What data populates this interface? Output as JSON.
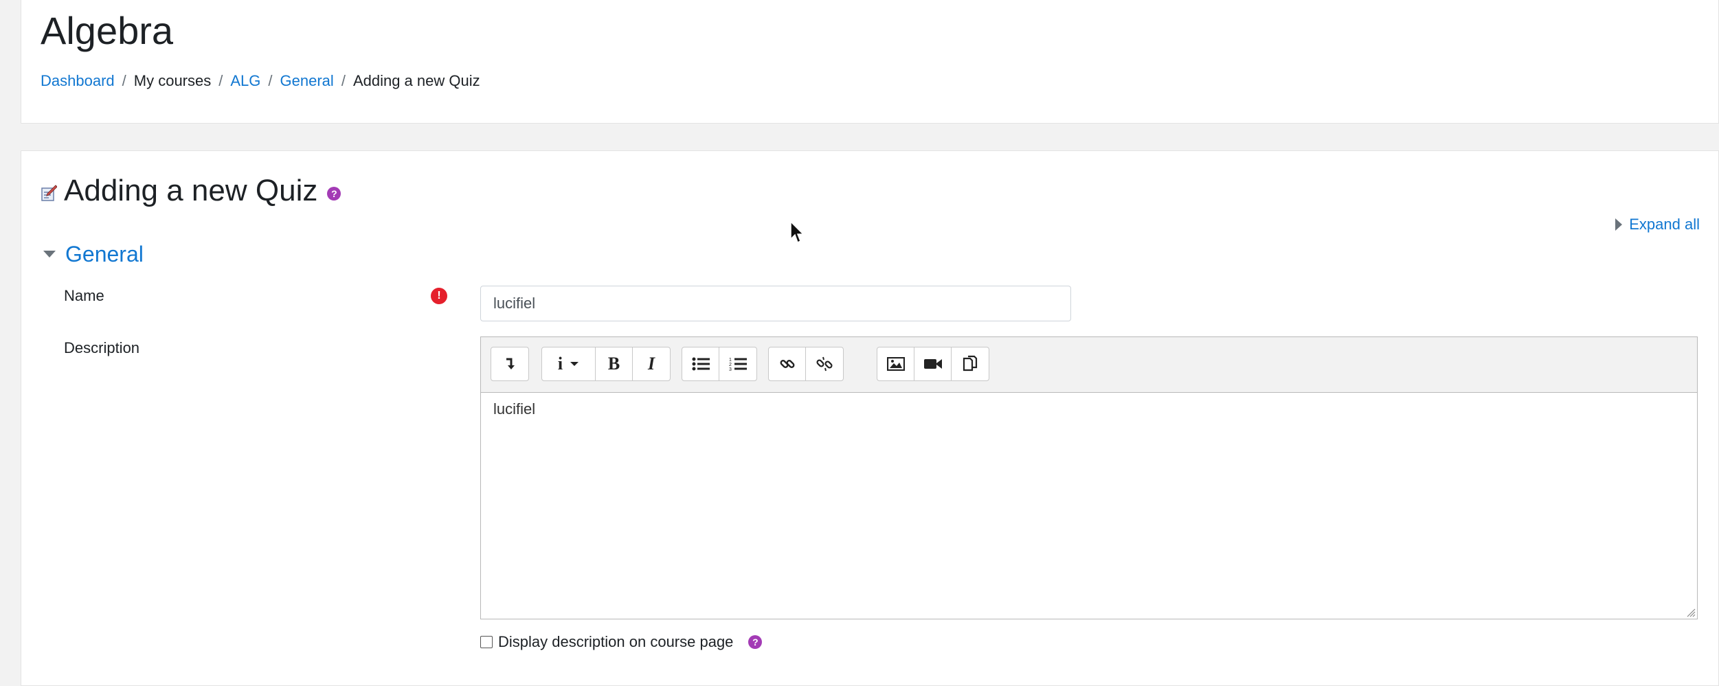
{
  "header": {
    "course_title": "Algebra",
    "breadcrumb": [
      {
        "label": "Dashboard",
        "link": true
      },
      {
        "label": "My courses",
        "link": false
      },
      {
        "label": "ALG",
        "link": true
      },
      {
        "label": "General",
        "link": true
      },
      {
        "label": "Adding a new Quiz",
        "link": false
      }
    ],
    "separator": "/"
  },
  "main": {
    "heading": "Adding a new Quiz",
    "help_glyph": "?",
    "expand_all": "Expand all",
    "section": {
      "title": "General"
    },
    "fields": {
      "name_label": "Name",
      "name_value": "lucifiel",
      "required_glyph": "!",
      "description_label": "Description",
      "description_value": "lucifiel",
      "show_description_label": "Display description on course page",
      "show_description_checked": false
    },
    "toolbar": {
      "buttons": [
        {
          "icon": "show-more-icon",
          "glyph": "↴"
        },
        {
          "icon": "info-dropdown-icon",
          "glyph": "i ▾"
        },
        {
          "icon": "bold-icon",
          "glyph": "B"
        },
        {
          "icon": "italic-icon",
          "glyph": "I"
        },
        {
          "icon": "unordered-list-icon",
          "glyph": ""
        },
        {
          "icon": "ordered-list-icon",
          "glyph": ""
        },
        {
          "icon": "link-icon",
          "glyph": ""
        },
        {
          "icon": "unlink-icon",
          "glyph": ""
        },
        {
          "icon": "image-icon",
          "glyph": ""
        },
        {
          "icon": "media-icon",
          "glyph": ""
        },
        {
          "icon": "manage-files-icon",
          "glyph": ""
        }
      ]
    }
  },
  "colors": {
    "link": "#1177d1",
    "help": "#a33bb5",
    "required": "#e5202c",
    "page_bg": "#f2f2f2"
  }
}
